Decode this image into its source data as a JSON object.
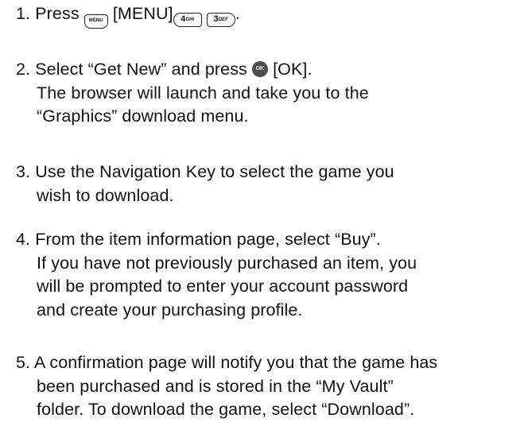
{
  "steps": [
    {
      "num": "1.",
      "pre": "Press",
      "keys": {
        "menu_icon": "MENU",
        "key4_main": "4",
        "key4_sub": "GHI",
        "key3_main": "3",
        "key3_sub": "DEF"
      },
      "menu_label": "[MENU]",
      "end": "."
    },
    {
      "num": "2.",
      "pre": "Select “Get New” and press",
      "ok_icon": "OK",
      "ok_label": "[OK].",
      "lines": [
        "The browser will launch and take you to the",
        "“Graphics” download menu."
      ]
    },
    {
      "num": "3.",
      "lines": [
        "Use the Navigation Key to select the game you",
        "wish to download."
      ]
    },
    {
      "num": "4.",
      "lines": [
        "From the item information page, select “Buy”.",
        "If you have not previously purchased an item, you",
        "will be prompted to enter your account password",
        "and create your purchasing profile."
      ]
    },
    {
      "num": "5.",
      "lines": [
        "A confirmation page will notify you that the game has",
        "been purchased and is stored in the “My Vault”",
        "folder. To download the game, select “Download”."
      ]
    }
  ]
}
